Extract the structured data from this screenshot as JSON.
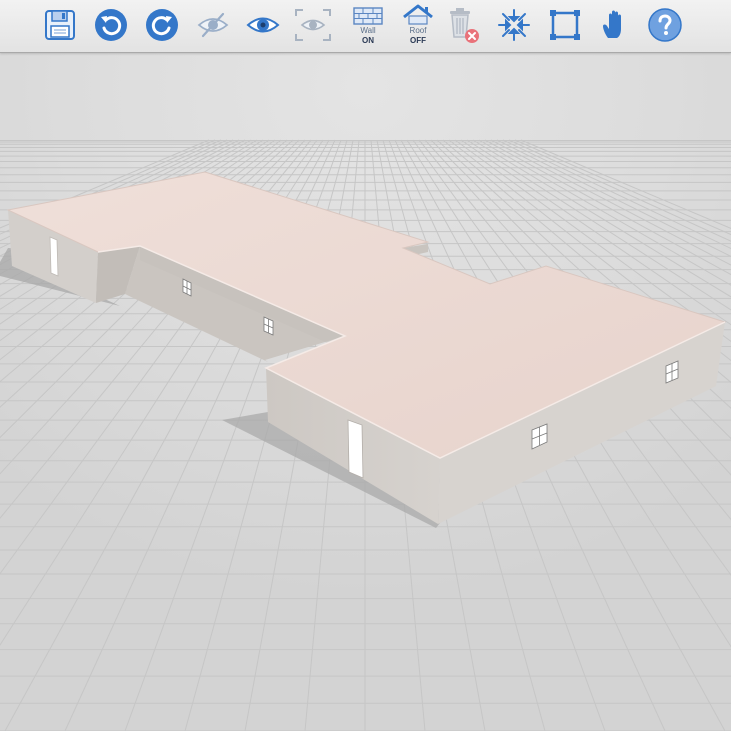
{
  "toolbar": {
    "buttons": [
      {
        "id": "save",
        "icon": "floppy-disk-icon"
      },
      {
        "id": "undo",
        "icon": "undo-arrow-icon"
      },
      {
        "id": "redo",
        "icon": "redo-arrow-icon"
      },
      {
        "id": "hide",
        "icon": "eye-slash-icon"
      },
      {
        "id": "show",
        "icon": "eye-icon"
      },
      {
        "id": "focus",
        "icon": "eye-frame-icon"
      },
      {
        "id": "wall_toggle",
        "icon": "brick-wall-icon",
        "label": "Wall",
        "state": "ON"
      },
      {
        "id": "roof_toggle",
        "icon": "house-roof-icon",
        "label": "Roof",
        "state": "OFF"
      },
      {
        "id": "delete",
        "icon": "trash-can-icon"
      },
      {
        "id": "shrink",
        "icon": "arrows-inward-icon"
      },
      {
        "id": "select_area",
        "icon": "selection-square-icon"
      },
      {
        "id": "pan",
        "icon": "hand-icon"
      },
      {
        "id": "help",
        "icon": "question-mark-icon"
      }
    ]
  },
  "colors": {
    "toolbar_blue": "#3477c9",
    "roof": "#ecd9d3",
    "wall_light": "#d5d1cd",
    "wall_dark": "#bab5b0",
    "grid_background": "#d9d9d9",
    "grid_line": "#c4c4c4",
    "delete_badge": "#e9727a"
  },
  "scene": {
    "object": "building-model",
    "walls_visible": true,
    "roof_visible": false
  }
}
